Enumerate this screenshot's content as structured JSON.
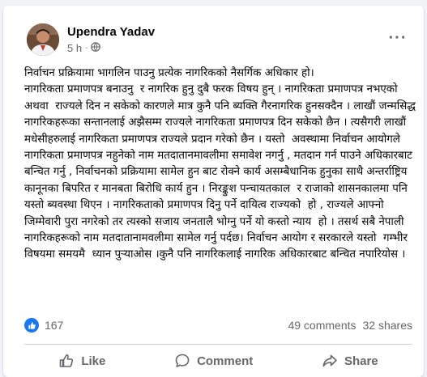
{
  "post": {
    "author": "Upendra Yadav",
    "time": "5 h",
    "separator": "·",
    "more_label": "···",
    "text": "निर्वाचन प्रक्रियामा भागलिन पाउनु प्रत्येक नागरिकको नैसर्गिक अधिकार हो।\nनागरिकता प्रमाणपत्र बनाउनु  र नागरिक हुनु दुबै फरक विषय हुन् । नागरिकता प्रमाणपत्र नभएको  अथवा  राज्यले दिन न सकेको कारणले मात्र कुनै पनि ब्यक्ति गैरनागरिक हुनसक्दैन । लाखौं जन्मसिद्ध नागरिकहरूका सन्तानलाई अझैसम्म राज्यले नागरिकता प्रमाणपत्र दिन सकेको छैन । त्यसैगरी लाखौं मधेसीहरुलाई नागरिकता प्रमाणपत्र राज्यले प्रदान गरेको छैन । यस्तो  अवस्थामा निर्वाचन आयोगले नागरिकता प्रमाणपत्र नहुनेको नाम मतदातानमावलीमा समावेश नगर्नु , मतदान गर्न पाउने अधिकारबाट बन्चित गर्नु , निर्वाचनको प्रक्रियामा सामेल हुन बाट रोक्ने कार्य असम्बैधानिक हुनुका साथै अन्तर्राष्ट्रिय कानूनका बिपरित र मानबता बिरोधि कार्य हुन । निरङ्कुश पन्चायतकाल  र राजाको शासनकालमा पनि यस्तो ब्यवस्था थिएन । नागरिकताको प्रमाणपत्र दिनु पर्ने दायित्व राज्यको  हो , राज्यले आफ्नो जिम्मेवारी पुरा नगरेको तर त्यस्को सजाय जनतालै भोग्नु पर्ने यो कस्तो न्याय  हो । तसर्थ सबै नेपाली नागरिकहरूको नाम मतदातानामवलीमा सामेल गर्नु पर्दछ। निर्वाचन आयोग र सरकारले यस्तो  गम्भीर विषयमा समयमै  ध्यान पुर्‍याओस ।कुनै पनि नागरिकलाई नागरिक अधिकारबाट बन्चित नपारियोस ।"
  },
  "stats": {
    "reactions_count": "167",
    "comments": "49 comments",
    "shares": "32 shares"
  },
  "actions": {
    "like": "Like",
    "comment": "Comment",
    "share": "Share"
  },
  "colors": {
    "accent": "#1877f2",
    "secondary_text": "#65676b",
    "primary_text": "#050505",
    "background": "#f0f2f5"
  },
  "icons": {
    "like_badge": "thumbs-up-icon",
    "globe": "globe-icon",
    "more": "more-options-icon",
    "like_action": "like-icon",
    "comment_action": "comment-icon",
    "share_action": "share-icon"
  }
}
